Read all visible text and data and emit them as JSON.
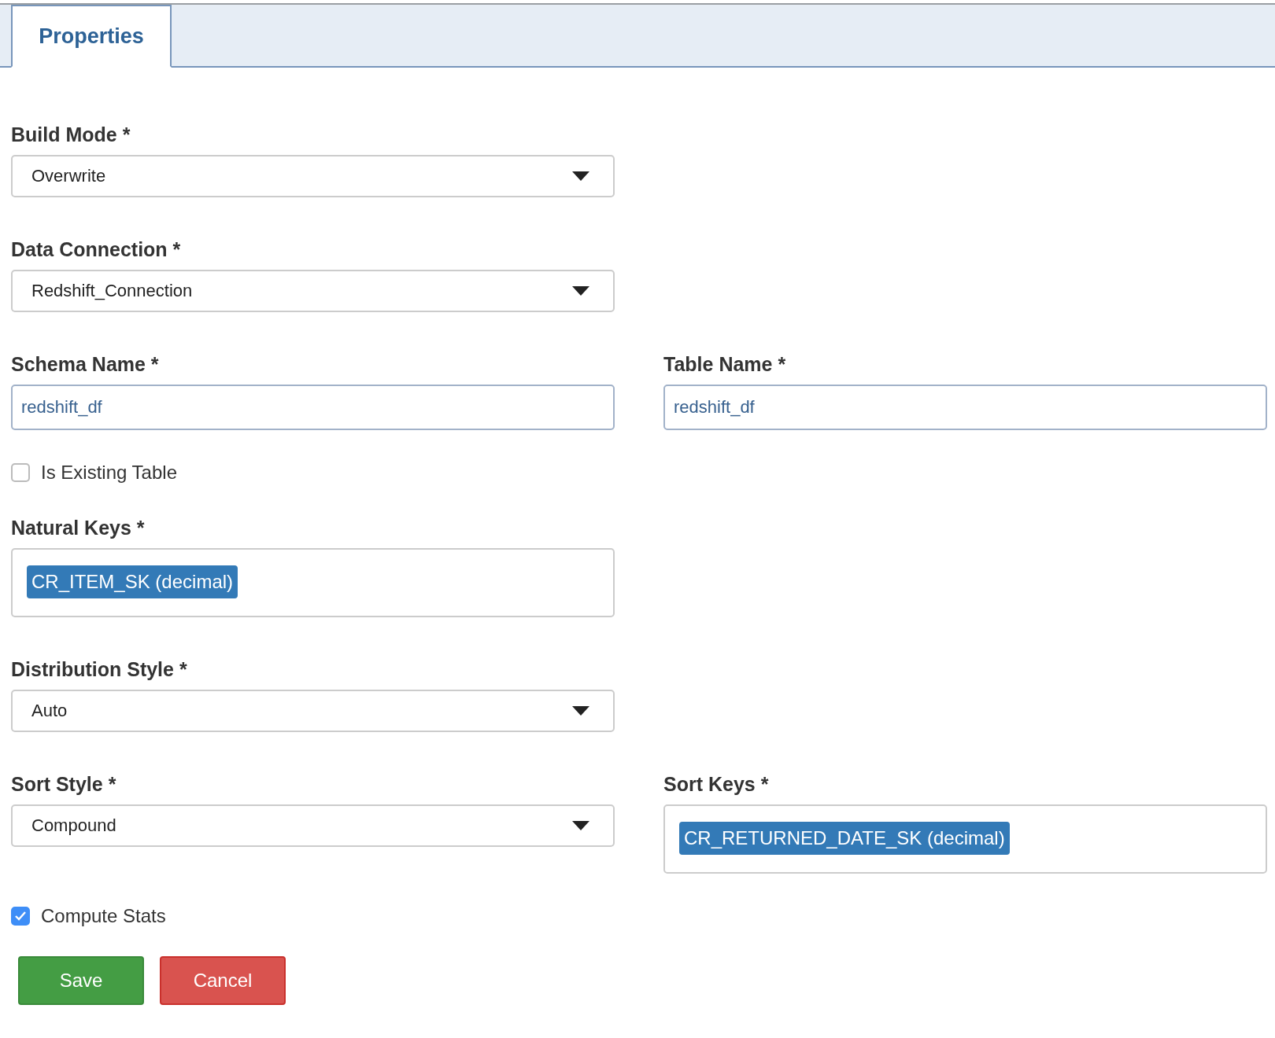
{
  "tabs": [
    {
      "label": "Properties",
      "selected": true
    }
  ],
  "rows": [
    {
      "fields": [
        {
          "kind": "select",
          "label": "Build Mode *",
          "value": "Overwrite"
        }
      ]
    },
    {
      "fields": [
        {
          "kind": "select",
          "label": "Data Connection *",
          "value": "Redshift_Connection"
        }
      ]
    },
    {
      "fields": [
        {
          "kind": "text",
          "label": "Schema Name *",
          "value": "redshift_df"
        },
        {
          "kind": "text",
          "label": "Table Name *",
          "value": "redshift_df"
        }
      ]
    },
    {
      "fields": [
        {
          "kind": "checkbox",
          "label": "Is Existing Table",
          "checked": false
        }
      ]
    },
    {
      "fields": [
        {
          "kind": "tags",
          "label": "Natural Keys *",
          "tags": [
            "CR_ITEM_SK (decimal)"
          ]
        }
      ]
    },
    {
      "fields": [
        {
          "kind": "select",
          "label": "Distribution Style *",
          "value": "Auto"
        }
      ]
    },
    {
      "fields": [
        {
          "kind": "select",
          "label": "Sort Style *",
          "value": "Compound"
        },
        {
          "kind": "tags",
          "label": "Sort Keys *",
          "tags": [
            "CR_RETURNED_DATE_SK (decimal)"
          ]
        }
      ]
    },
    {
      "fields": [
        {
          "kind": "checkbox",
          "label": "Compute Stats",
          "checked": true
        }
      ]
    }
  ],
  "buttons": [
    {
      "label": "Save",
      "kind": "primary"
    },
    {
      "label": "Cancel",
      "kind": "danger"
    }
  ]
}
